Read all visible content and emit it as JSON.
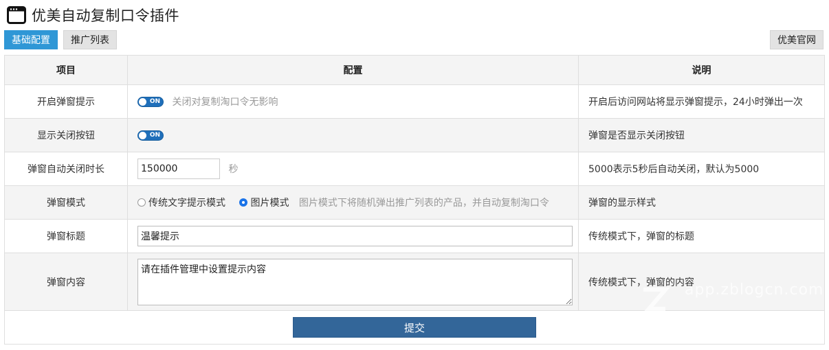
{
  "header": {
    "title": "优美自动复制口令插件",
    "icon": "window-icon"
  },
  "tabs": [
    {
      "label": "基础配置",
      "active": true
    },
    {
      "label": "推广列表",
      "active": false
    }
  ],
  "official_link": "优美官网",
  "table": {
    "headers": [
      "项目",
      "配置",
      "说明"
    ],
    "rows": {
      "popup_hint": {
        "label": "开启弹窗提示",
        "toggle_text": "ON",
        "hint": "关闭对复制淘口令无影响",
        "desc": "开启后访问网站将显示弹窗提示，24小时弹出一次"
      },
      "close_button": {
        "label": "显示关闭按钮",
        "toggle_text": "ON",
        "desc": "弹窗是否显示关闭按钮"
      },
      "auto_close": {
        "label": "弹窗自动关闭时长",
        "value": "150000",
        "unit": "秒",
        "desc": "5000表示5秒后自动关闭，默认为5000"
      },
      "mode": {
        "label": "弹窗模式",
        "options": [
          "传统文字提示模式",
          "图片模式"
        ],
        "selected": "图片模式",
        "hint": "图片模式下将随机弹出推广列表的产品，并自动复制淘口令",
        "desc": "弹窗的显示样式"
      },
      "title": {
        "label": "弹窗标题",
        "value": "温馨提示",
        "desc": "传统模式下，弹窗的标题"
      },
      "content": {
        "label": "弹窗内容",
        "value": "请在插件管理中设置提示内容",
        "desc": "传统模式下，弹窗的内容"
      }
    }
  },
  "submit_label": "提交",
  "watermark": {
    "text": "app.zblogcn.com"
  },
  "colors": {
    "accent": "#2f97d6",
    "submit": "#336699",
    "toggle": "#1f6fba"
  }
}
